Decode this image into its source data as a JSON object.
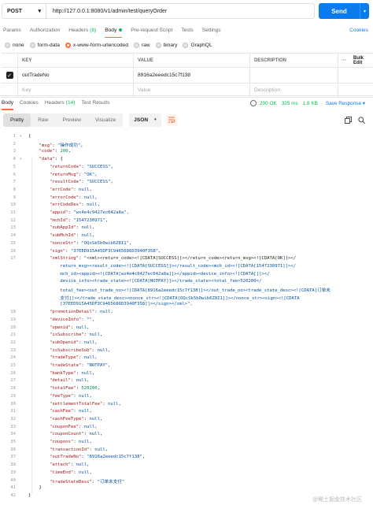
{
  "request": {
    "method": "POST",
    "url": "http://127.0.0.1:8080/v1/admin/test/queryOrder",
    "send_label": "Send"
  },
  "request_tabs": [
    {
      "label": "Params"
    },
    {
      "label": "Authorization"
    },
    {
      "label": "Headers",
      "count": "(8)"
    },
    {
      "label": "Body",
      "active": true
    },
    {
      "label": "Pre-request Script"
    },
    {
      "label": "Tests"
    },
    {
      "label": "Settings"
    }
  ],
  "cookies_label": "Cookies",
  "body_types": [
    "none",
    "form-data",
    "x-www-form-urlencoded",
    "raw",
    "binary",
    "GraphQL"
  ],
  "body_type_selected": "x-www-form-urlencoded",
  "params_table": {
    "headers": [
      "KEY",
      "VALUE",
      "DESCRIPTION"
    ],
    "more_label": "···",
    "bulk_edit": "Bulk Edit",
    "rows": [
      {
        "key": "outTradeNo",
        "value": "8916a2eeedc15c7f138",
        "description": ""
      }
    ],
    "placeholders": {
      "key": "Key",
      "value": "Value",
      "description": "Description"
    }
  },
  "response_tabs": [
    {
      "label": "Body",
      "active": true
    },
    {
      "label": "Cookies"
    },
    {
      "label": "Headers",
      "count": "(14)"
    },
    {
      "label": "Test Results"
    }
  ],
  "response_meta": {
    "status": "200 OK",
    "time": "325 ms",
    "size": "1.8 KB",
    "save_label": "Save Response"
  },
  "format_tabs": [
    "Pretty",
    "Raw",
    "Preview",
    "Visualize"
  ],
  "format_selected": "Pretty",
  "format_lang": "JSON",
  "code_lines": [
    "{",
    "    \"msg\": \"操作成功\",",
    "    \"code\": 200,",
    "    \"data\": {",
    "        \"returnCode\": \"SUCCESS\",",
    "        \"returnMsg\": \"OK\",",
    "        \"resultCode\": \"SUCCESS\",",
    "        \"errCode\": null,",
    "        \"errorCode\": null,",
    "        \"errCodeDes\": null,",
    "        \"appid\": \"wx4e4c9427ec042a8a\",",
    "        \"mchId\": \"1547230971\",",
    "        \"subAppId\": null,",
    "        \"subMchId\": null,",
    "        \"nonceStr\": \"OQcSk5b0wib6Z8I1\",",
    "        \"sign\": \"37EED915A45DF3C9465686D3940F358\",",
    "        \"xmlString\": \"<xml><return_code><![CDATA[SUCCESS]]></return_code><return_msg><![CDATA[OK]]></",
    "            return_msg><result_code><![CDATA[SUCCESS]]></result_code><mch_id><![CDATA[1547230971]]></",
    "            mch_id><appid><![CDATA[wx4e4c9427ec042a8a]]></appid><device_info><![CDATA[]]></",
    "            device_info><trade_state><![CDATA[NOTPAY]]></trade_state><total_fee>520200</",
    "            total_fee><out_trade_no><![CDATA[8916a2eeedc15c7f138]]></out_trade_no><trade_state_desc><![CDATA[订单未",
    "            支付]]></trade_state_desc><nonce_str><![CDATA[OQcSk5b0wib6Z8I1]]></nonce_str><sign><![CDATA",
    "            [37EED915A45DF3C9465686D3940F358]]></sign></xml>\",",
    "        \"promotionDetail\": null,",
    "        \"deviceInfo\": \"\",",
    "        \"openid\": null,",
    "        \"isSubscribe\": null,",
    "        \"subOpenid\": null,",
    "        \"isSubscribeSub\": null,",
    "        \"tradeType\": null,",
    "        \"tradeState\": \"NOTPAY\",",
    "        \"bankType\": null,",
    "        \"detail\": null,",
    "        \"totalFee\": 520200,",
    "        \"feeType\": null,",
    "        \"settlementTotalFee\": null,",
    "        \"cashFee\": null,",
    "        \"cashFeeType\": null,",
    "        \"couponFee\": null,",
    "        \"couponCount\": null,",
    "        \"coupons\": null,",
    "        \"transactionId\": null,",
    "        \"outTradeNo\": \"8916a2eeedc15c7f138\",",
    "        \"attach\": null,",
    "        \"timeEnd\": null,",
    "        \"tradeStateDesc\": \"订单未支付\"",
    "    }",
    "}"
  ],
  "line_numbers": [
    "1",
    "2",
    "3",
    "4",
    "5",
    "6",
    "7",
    "8",
    "9",
    "10",
    "11",
    "12",
    "13",
    "14",
    "15",
    "16",
    "17",
    "",
    "",
    "",
    "",
    "",
    "",
    "18",
    "19",
    "20",
    "21",
    "22",
    "23",
    "24",
    "25",
    "26",
    "27",
    "28",
    "29",
    "30",
    "31",
    "32",
    "33",
    "34",
    "35",
    "36",
    "37",
    "38",
    "39",
    "40",
    "41",
    "42",
    "43",
    "44",
    "45",
    "46"
  ],
  "watermark": "@稀土掘金技术社区"
}
